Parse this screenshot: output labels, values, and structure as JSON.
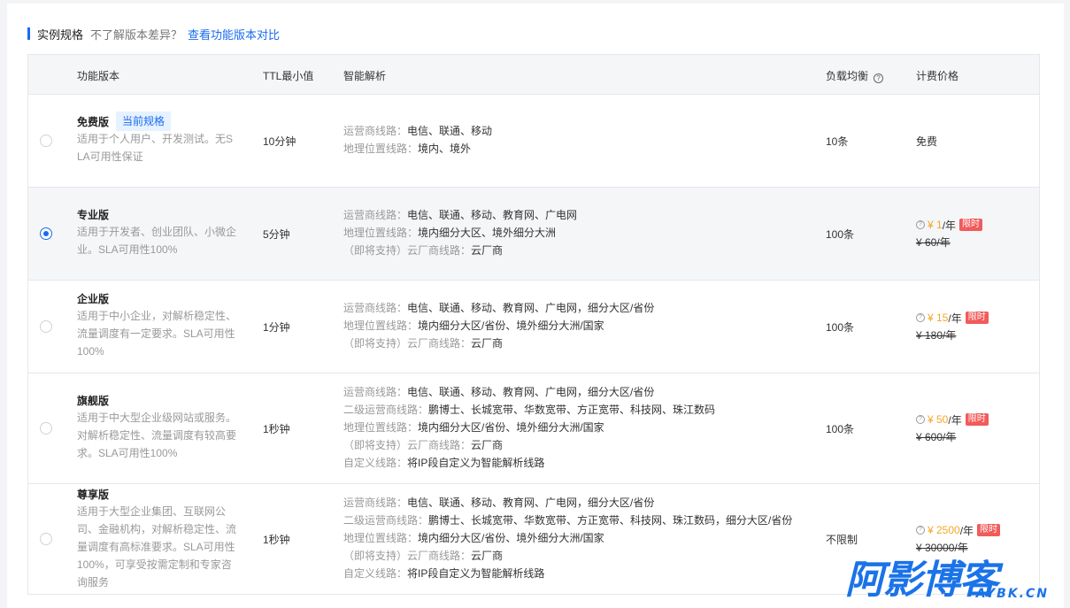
{
  "header": {
    "title": "实例规格",
    "hint": "不了解版本差异？",
    "link": "查看功能版本对比"
  },
  "columns": {
    "name": "功能版本",
    "ttl": "TTL最小值",
    "dns": "智能解析",
    "lb": "负载均衡",
    "price": "计费价格"
  },
  "plans": [
    {
      "name": "免费版",
      "badge": "当前规格",
      "desc": "适用于个人用户、开发测试。无SLA可用性保证",
      "ttl": "10分钟",
      "dns": [
        {
          "k": "运营商线路：",
          "v": "电信、联通、移动"
        },
        {
          "k": "地理位置线路：",
          "v": "境内、境外"
        }
      ],
      "lb": "10条",
      "price": {
        "free": "免费"
      }
    },
    {
      "name": "专业版",
      "desc": "适用于开发者、创业团队、小微企业。SLA可用性100%",
      "ttl": "5分钟",
      "dns": [
        {
          "k": "运营商线路：",
          "v": "电信、联通、移动、教育网、广电网"
        },
        {
          "k": "地理位置线路：",
          "v": "境内细分大区、境外细分大洲"
        },
        {
          "k": "（即将支持）云厂商线路：",
          "v": "云厂商"
        }
      ],
      "lb": "100条",
      "price": {
        "now": "¥ 1",
        "unit": "/年",
        "tag": "限时",
        "old": "¥ 60/年"
      }
    },
    {
      "name": "企业版",
      "desc": "适用于中小企业，对解析稳定性、流量调度有一定要求。SLA可用性100%",
      "ttl": "1分钟",
      "dns": [
        {
          "k": "运营商线路：",
          "v": "电信、联通、移动、教育网、广电网，细分大区/省份"
        },
        {
          "k": "地理位置线路：",
          "v": "境内细分大区/省份、境外细分大洲/国家"
        },
        {
          "k": "（即将支持）云厂商线路：",
          "v": "云厂商"
        }
      ],
      "lb": "100条",
      "price": {
        "now": "¥ 15",
        "unit": "/年",
        "tag": "限时",
        "old": "¥ 180/年"
      }
    },
    {
      "name": "旗舰版",
      "desc": "适用于中大型企业级网站或服务。对解析稳定性、流量调度有较高要求。SLA可用性100%",
      "ttl": "1秒钟",
      "dns": [
        {
          "k": "运营商线路：",
          "v": "电信、联通、移动、教育网、广电网，细分大区/省份"
        },
        {
          "k": "二级运营商线路：",
          "v": "鹏博士、长城宽带、华数宽带、方正宽带、科技网、珠江数码"
        },
        {
          "k": "地理位置线路：",
          "v": "境内细分大区/省份、境外细分大洲/国家"
        },
        {
          "k": "（即将支持）云厂商线路：",
          "v": "云厂商"
        },
        {
          "k": "自定义线路：",
          "v": "将IP段自定义为智能解析线路"
        }
      ],
      "lb": "100条",
      "price": {
        "now": "¥ 50",
        "unit": "/年",
        "tag": "限时",
        "old": "¥ 600/年"
      }
    },
    {
      "name": "尊享版",
      "desc": "适用于大型企业集团、互联网公司、金融机构，对解析稳定性、流量调度有高标准要求。SLA可用性100%，可享受按需定制和专家咨询服务",
      "ttl": "1秒钟",
      "dns": [
        {
          "k": "运营商线路：",
          "v": "电信、联通、移动、教育网、广电网，细分大区/省份"
        },
        {
          "k": "二级运营商线路：",
          "v": "鹏博士、长城宽带、华数宽带、方正宽带、科技网、珠江数码，细分大区/省份"
        },
        {
          "k": "地理位置线路：",
          "v": "境内细分大区/省份、境外细分大洲/国家"
        },
        {
          "k": "（即将支持）云厂商线路：",
          "v": "云厂商"
        },
        {
          "k": "自定义线路：",
          "v": "将IP段自定义为智能解析线路"
        }
      ],
      "lb": "不限制",
      "price": {
        "now": "¥ 2500",
        "unit": "/年",
        "tag": "限时",
        "old": "¥ 30000/年"
      }
    }
  ],
  "selected_index": 1,
  "watermark": {
    "main": "阿影博客",
    "sub": "AYBK.CN"
  },
  "colors": {
    "accent": "#1a6bf0",
    "price": "#f5a623",
    "tag": "#f15b5b"
  }
}
